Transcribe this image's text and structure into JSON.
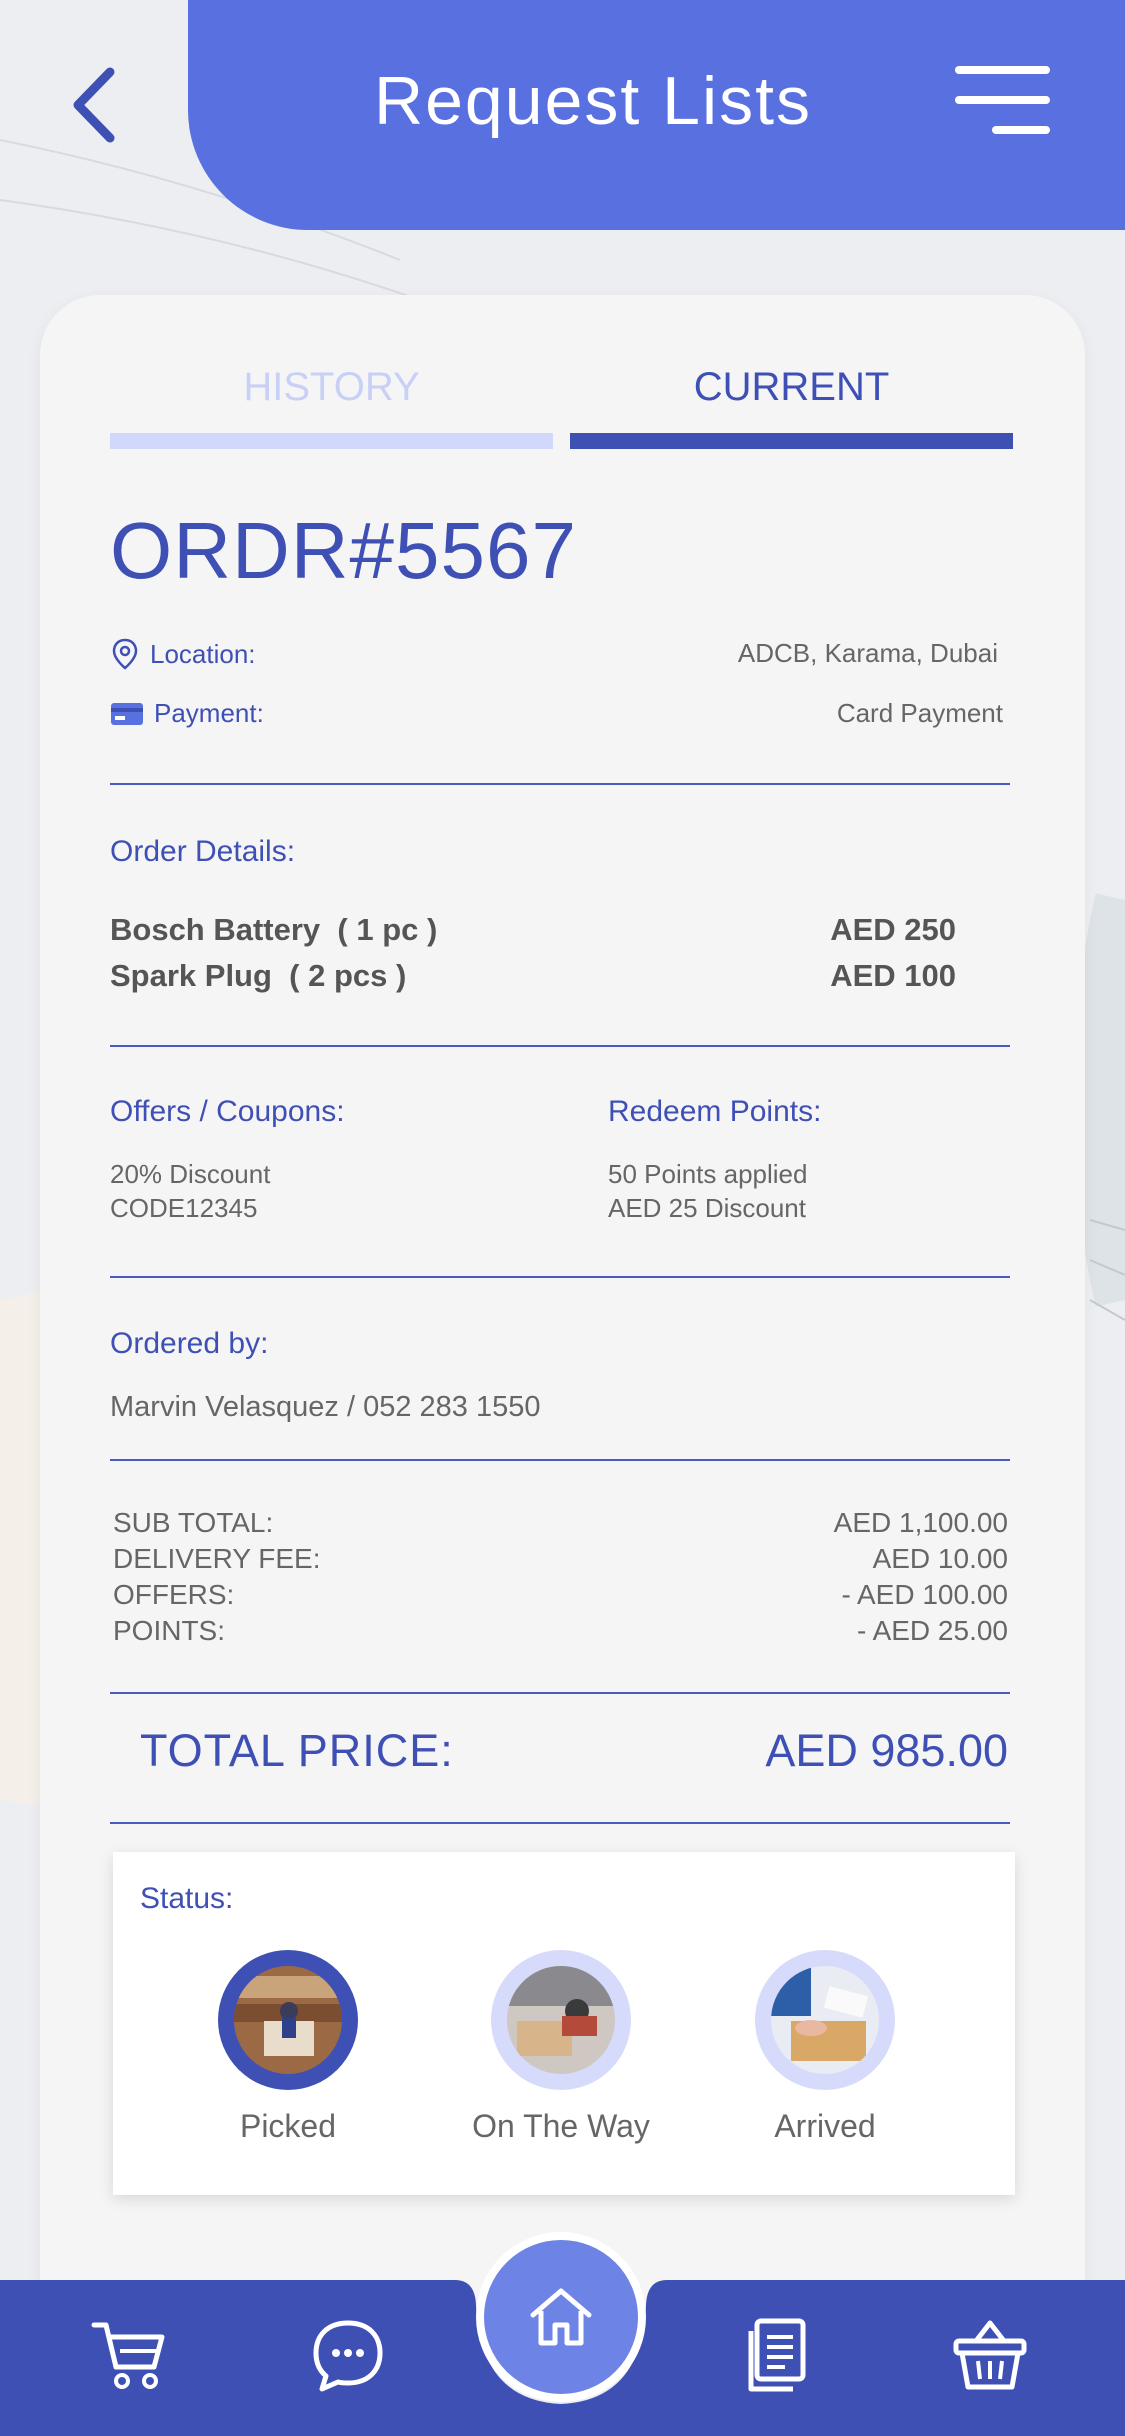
{
  "header": {
    "title": "Request Lists"
  },
  "tabs": [
    {
      "label": "HISTORY"
    },
    {
      "label": "CURRENT"
    }
  ],
  "order": {
    "id": "ORDR#5567",
    "location_label": "Location:",
    "location_value": "ADCB, Karama, Dubai",
    "payment_label": "Payment:",
    "payment_value": "Card Payment"
  },
  "order_details": {
    "title": "Order Details:",
    "items": [
      {
        "name": "Bosch Battery  ( 1 pc )",
        "price": "AED 250"
      },
      {
        "name": "Spark Plug  ( 2 pcs )",
        "price": "AED 100"
      }
    ]
  },
  "offers": {
    "title": "Offers / Coupons:",
    "line1": "20% Discount",
    "line2": "CODE12345"
  },
  "redeem": {
    "title": "Redeem Points:",
    "line1": "50 Points applied",
    "line2": "AED 25 Discount"
  },
  "ordered_by": {
    "title": "Ordered by:",
    "value": "Marvin Velasquez / 052 283 1550"
  },
  "summary": [
    {
      "label": "SUB TOTAL:",
      "value": "AED 1,100.00"
    },
    {
      "label": "DELIVERY FEE:",
      "value": "AED 10.00"
    },
    {
      "label": "OFFERS:",
      "value": "- AED 100.00"
    },
    {
      "label": "POINTS:",
      "value": "- AED 25.00"
    }
  ],
  "total": {
    "label": "TOTAL PRICE:",
    "value": "AED 985.00"
  },
  "status": {
    "title": "Status:",
    "steps": [
      {
        "label": "Picked",
        "state": "active"
      },
      {
        "label": "On The Way",
        "state": "pending"
      },
      {
        "label": "Arrived",
        "state": "pending"
      }
    ]
  },
  "nav": {
    "icons": [
      "cart-icon",
      "chat-icon",
      "home-icon",
      "document-icon",
      "basket-icon"
    ],
    "color": "#3f50b5"
  },
  "colors": {
    "primary": "#3f50b5",
    "header": "#5970e0",
    "accent_light": "#d6dbfb"
  }
}
